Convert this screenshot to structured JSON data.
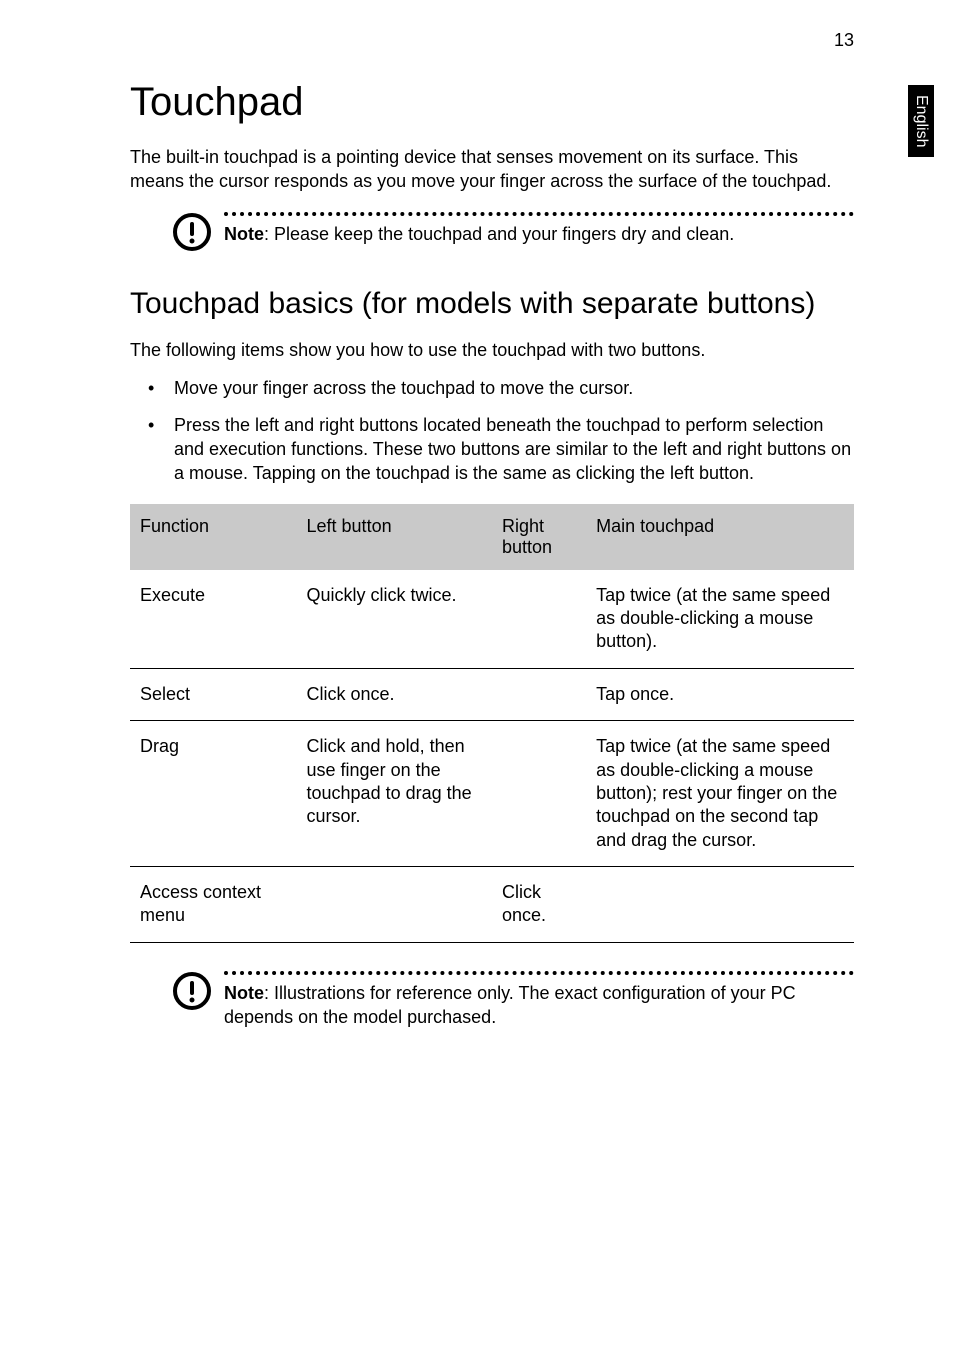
{
  "page_number": "13",
  "side_tab": "English",
  "title": "Touchpad",
  "intro": "The built-in touchpad is a pointing device that senses movement on its surface. This means the cursor responds as you move your finger across the surface of the touchpad.",
  "note1_label": "Note",
  "note1_text": ": Please keep the touchpad and your fingers dry and clean.",
  "subtitle": "Touchpad basics (for models with separate buttons)",
  "para2": "The following items show you how to use the touchpad with two buttons.",
  "bullets": [
    "Move your finger across the touchpad to move the cursor.",
    "Press the left and right buttons located beneath the touchpad to perform selection and execution functions. These two buttons are similar to the left and right buttons on a mouse. Tapping on the touchpad is the same as clicking the left button."
  ],
  "table": {
    "headers": [
      "Function",
      "Left button",
      "Right button",
      "Main touchpad"
    ],
    "rows": [
      {
        "c1": "Execute",
        "c2": "Quickly click twice.",
        "c3": "",
        "c4": "Tap twice (at the same speed as double-clicking a mouse button)."
      },
      {
        "c1": "Select",
        "c2": "Click once.",
        "c3": "",
        "c4": "Tap once."
      },
      {
        "c1": "Drag",
        "c2": "Click and hold, then use finger on the touchpad to drag the cursor.",
        "c3": "",
        "c4": "Tap twice (at the same speed as double-clicking a mouse button); rest your finger on the touchpad on the second tap and drag the cursor."
      },
      {
        "c1": "Access context menu",
        "c2": "",
        "c3": "Click once.",
        "c4": ""
      }
    ]
  },
  "note2_label": "Note",
  "note2_text": ": Illustrations for reference only. The exact configuration of your PC depends on the model purchased."
}
